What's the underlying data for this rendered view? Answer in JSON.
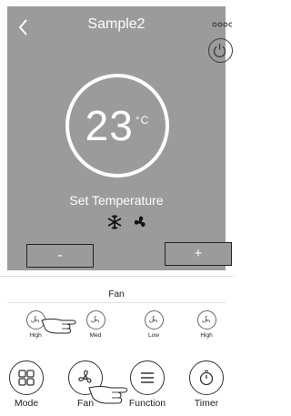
{
  "header": {
    "title": "Sample2",
    "back_icon": "chevron-left-icon",
    "more_icon": "more-dots-icon",
    "power_icon": "power-icon"
  },
  "thermostat": {
    "temperature": "23",
    "unit": "°C",
    "set_label": "Set Temperature",
    "mode_icons": [
      "snowflake-icon",
      "fan-icon"
    ]
  },
  "controls": {
    "minus_label": "-",
    "plus_label": "+"
  },
  "fan_section": {
    "title": "Fan",
    "options": [
      {
        "label": "High",
        "icon": "fan-speed-icon"
      },
      {
        "label": "Med",
        "icon": "fan-speed-icon"
      },
      {
        "label": "Low",
        "icon": "fan-speed-icon"
      },
      {
        "label": "High",
        "icon": "fan-speed-icon"
      }
    ]
  },
  "bottom_nav": {
    "items": [
      {
        "label": "Mode",
        "icon": "mode-grid-icon"
      },
      {
        "label": "Fan",
        "icon": "fan-icon"
      },
      {
        "label": "Function",
        "icon": "menu-icon"
      },
      {
        "label": "Timer",
        "icon": "timer-icon"
      }
    ]
  },
  "colors": {
    "panel_bg": "#9b9b9b",
    "text_on_panel": "#ffffff",
    "outline": "#333333"
  }
}
